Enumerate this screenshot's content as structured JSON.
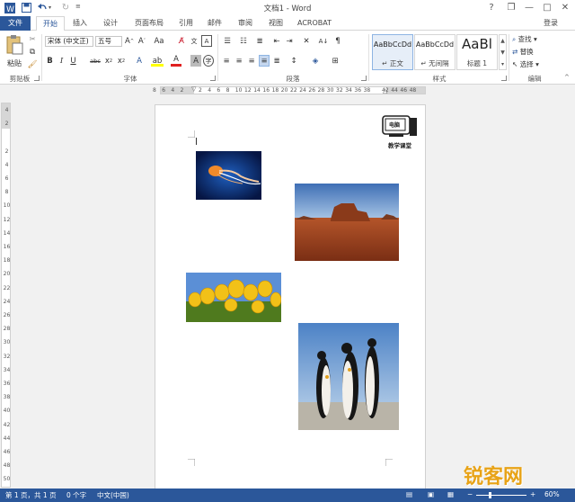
{
  "app": {
    "title": "文档1 - Word"
  },
  "quick_access": {
    "save_icon": "save-icon",
    "undo_icon": "undo-icon",
    "redo_icon": "redo-icon"
  },
  "window": {
    "help": "?",
    "restore": "❐",
    "minimize": "—",
    "maximize": "□",
    "close": "✕",
    "login": "登录"
  },
  "tabs": [
    "文件",
    "开始",
    "插入",
    "设计",
    "页面布局",
    "引用",
    "邮件",
    "审阅",
    "视图",
    "ACROBAT"
  ],
  "clipboard": {
    "paste_label": "粘贴",
    "group_label": "剪贴板"
  },
  "font": {
    "name": "宋体 (中文正)",
    "size": "五号",
    "group_label": "字体"
  },
  "paragraph": {
    "group_label": "段落"
  },
  "styles": {
    "group_label": "样式",
    "items": [
      {
        "sample": "AaBbCcDd",
        "name": "↵ 正文"
      },
      {
        "sample": "AaBbCcDd",
        "name": "↵ 无间隔"
      },
      {
        "sample": "AaBl",
        "name": "标题 1"
      }
    ]
  },
  "editing": {
    "find": "查找",
    "replace": "替换",
    "select": "选择",
    "group_label": "编辑"
  },
  "ruler": {
    "ticks": [
      "8",
      "6",
      "4",
      "2",
      "",
      "2",
      "4",
      "6",
      "8",
      "10",
      "12",
      "14",
      "16",
      "18",
      "20",
      "22",
      "24",
      "26",
      "28",
      "30",
      "32",
      "34",
      "36",
      "38",
      "",
      "42",
      "44",
      "46",
      "48"
    ]
  },
  "vruler": {
    "ticks": [
      "4",
      "2",
      "",
      "2",
      "4",
      "6",
      "8",
      "10",
      "12",
      "14",
      "16",
      "18",
      "20",
      "22",
      "24",
      "26",
      "28",
      "30",
      "32",
      "34",
      "36",
      "38",
      "40",
      "42",
      "44",
      "46",
      "48",
      "50"
    ]
  },
  "document": {
    "watermark_top": "电脑",
    "watermark_bottom": "教学课堂",
    "images": [
      {
        "name": "jellyfish-photo"
      },
      {
        "name": "desert-photo"
      },
      {
        "name": "tulips-photo"
      },
      {
        "name": "penguins-photo"
      }
    ]
  },
  "status": {
    "page": "第 1 页，共 1 页",
    "words": "0 个字",
    "language": "中文(中国)",
    "zoom": "60%",
    "brand": "锐客网"
  },
  "colors": {
    "accent": "#2b579a",
    "brand": "#e8a317"
  }
}
